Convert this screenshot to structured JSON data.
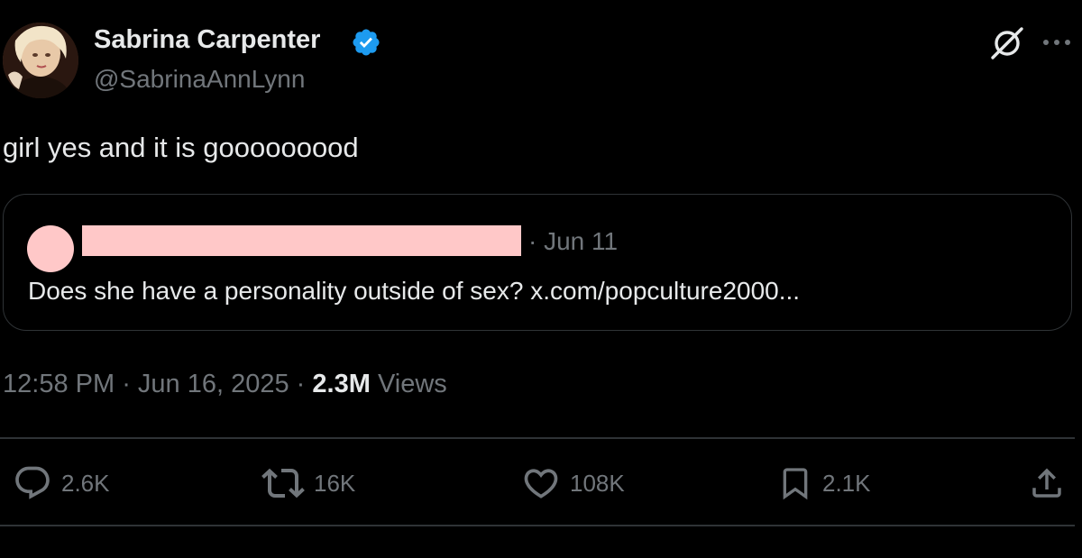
{
  "author": {
    "display_name": "Sabrina Carpenter",
    "handle": "@SabrinaAnnLynn",
    "verified": true
  },
  "tweet": {
    "text": "girl yes and it is gooooooood"
  },
  "quoted_tweet": {
    "date": "· Jun 11",
    "text": "Does she have a personality outside of sex? x.com/popculture2000..."
  },
  "meta": {
    "time": "12:58 PM",
    "separator1": " · ",
    "date": "Jun 16, 2025",
    "separator2": " · ",
    "views_count": "2.3M",
    "views_label": " Views"
  },
  "actions": {
    "replies": "2.6K",
    "reposts": "16K",
    "likes": "108K",
    "bookmarks": "2.1K"
  },
  "icons": {
    "verified": "verified-badge-icon",
    "grok": "grok-icon",
    "more": "more-icon",
    "reply": "reply-icon",
    "repost": "repost-icon",
    "like": "heart-icon",
    "bookmark": "bookmark-icon",
    "share": "share-icon"
  },
  "colors": {
    "background": "#000000",
    "text": "#e7e9ea",
    "secondary": "#71767b",
    "border": "#2f3336",
    "verified": "#1d9bf0",
    "redaction": "#ffc8c8"
  }
}
